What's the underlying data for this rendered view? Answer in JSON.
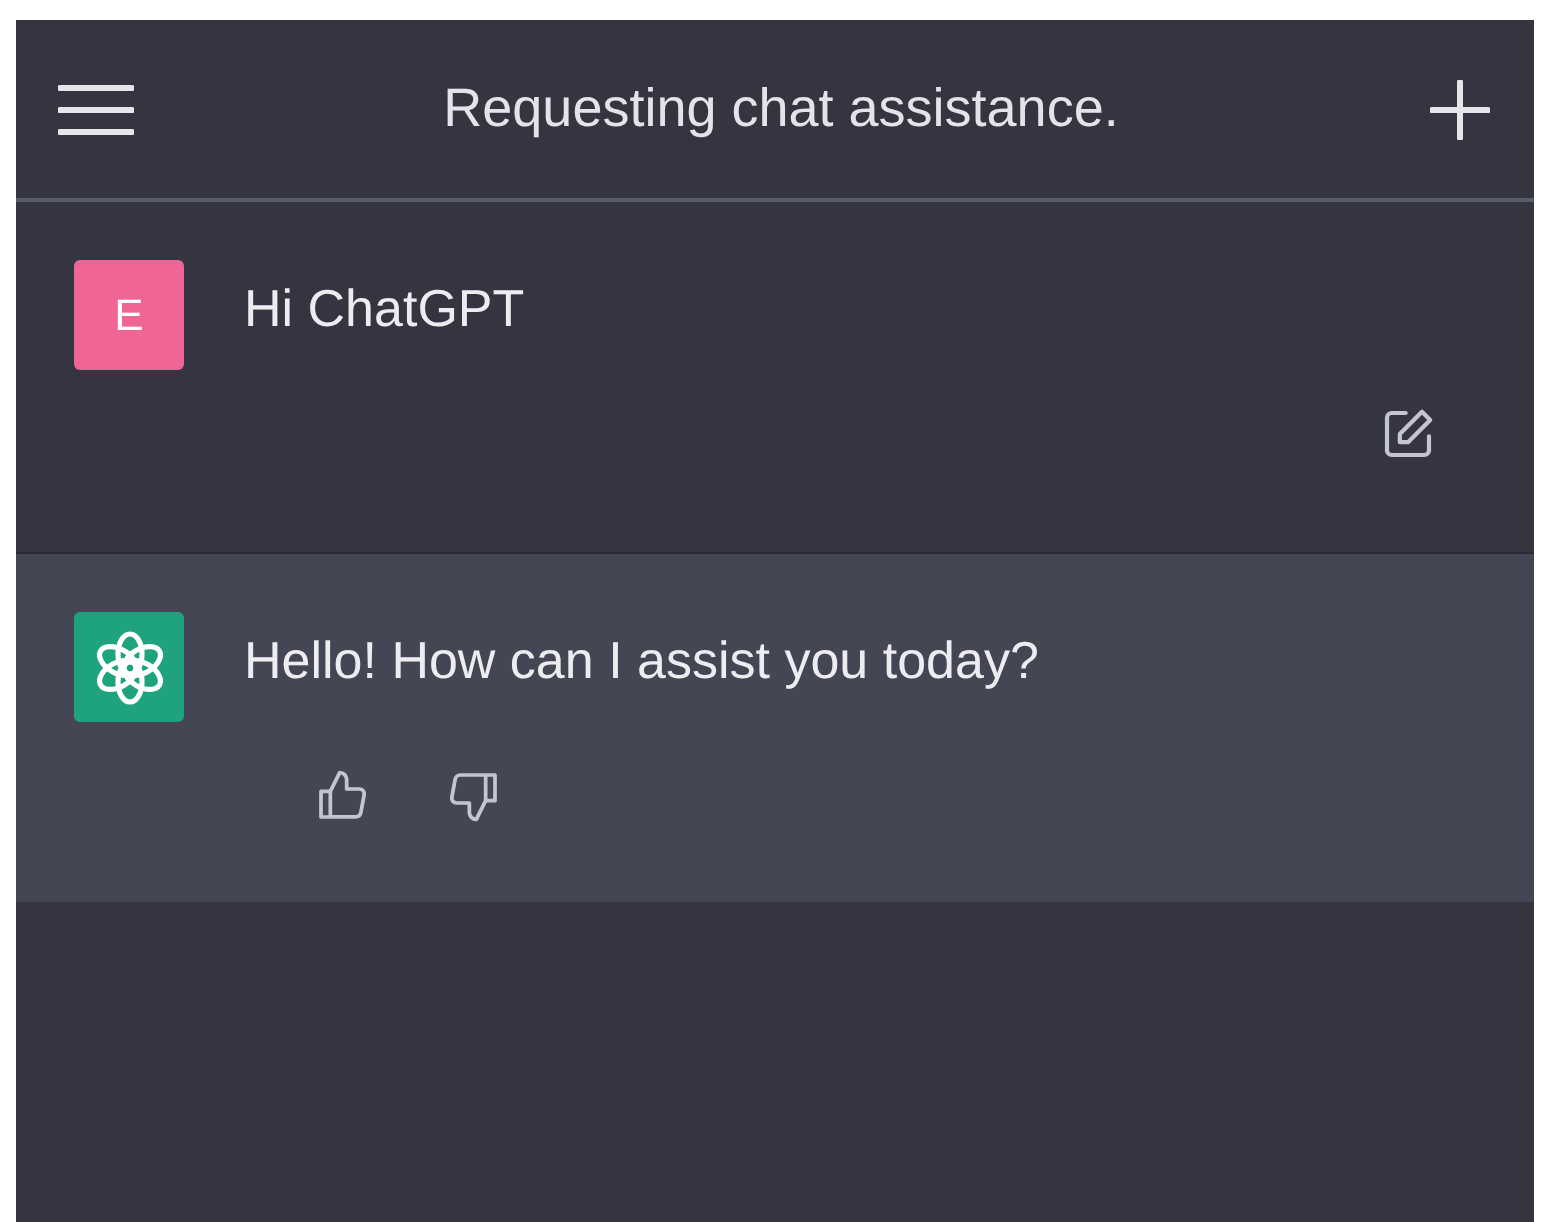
{
  "header": {
    "title": "Requesting chat assistance."
  },
  "messages": [
    {
      "kind": "user",
      "avatar_letter": "E",
      "color": "#ef6595",
      "text": "Hi ChatGPT"
    },
    {
      "kind": "assistant",
      "color": "#1fa37f",
      "text": "Hello! How can I assist you today?"
    }
  ]
}
